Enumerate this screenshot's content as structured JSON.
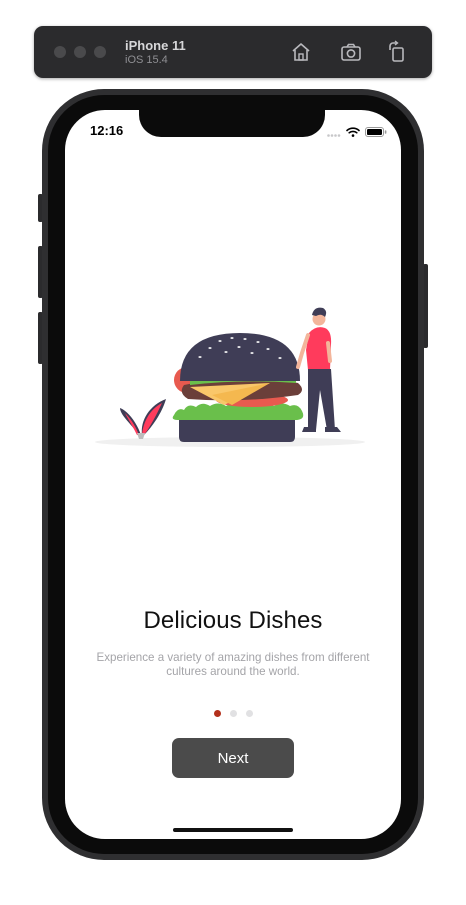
{
  "simulator": {
    "device_name": "iPhone 11",
    "os_version": "iOS 15.4",
    "toolbar_icons": [
      "home-icon",
      "screenshot-icon",
      "rotate-icon"
    ]
  },
  "status_bar": {
    "time": "12:16",
    "icons": [
      "signal-icon",
      "wifi-icon",
      "battery-icon"
    ]
  },
  "onboarding": {
    "illustration": "burger-illustration",
    "title": "Delicious Dishes",
    "subtitle": "Experience a variety of amazing dishes from different cultures around the world.",
    "page_indicator": {
      "count": 3,
      "active_index": 0
    },
    "next_label": "Next"
  },
  "colors": {
    "accent_dot": "#b3301c",
    "button_bg": "#4b4b4b",
    "bun": "#3f3d56",
    "shirt": "#ff3b5c",
    "lettuce": "#6abf4b",
    "cheese": "#f9c76a"
  }
}
